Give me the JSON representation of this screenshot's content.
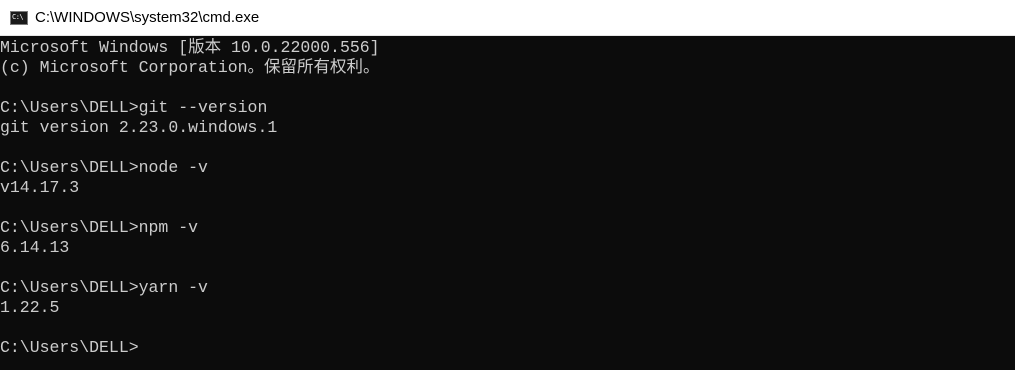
{
  "window": {
    "title": "C:\\WINDOWS\\system32\\cmd.exe",
    "icon_label": "C:\\",
    "icon": "cmd-console-icon"
  },
  "console": {
    "lines": [
      "Microsoft Windows [版本 10.0.22000.556]",
      "(c) Microsoft Corporation。保留所有权利。",
      "",
      "C:\\Users\\DELL>git --version",
      "git version 2.23.0.windows.1",
      "",
      "C:\\Users\\DELL>node -v",
      "v14.17.3",
      "",
      "C:\\Users\\DELL>npm -v",
      "6.14.13",
      "",
      "C:\\Users\\DELL>yarn -v",
      "1.22.5",
      "",
      "C:\\Users\\DELL>"
    ]
  },
  "colors": {
    "background": "#0c0c0c",
    "text": "#cccccc",
    "titlebar": "#ffffff"
  }
}
